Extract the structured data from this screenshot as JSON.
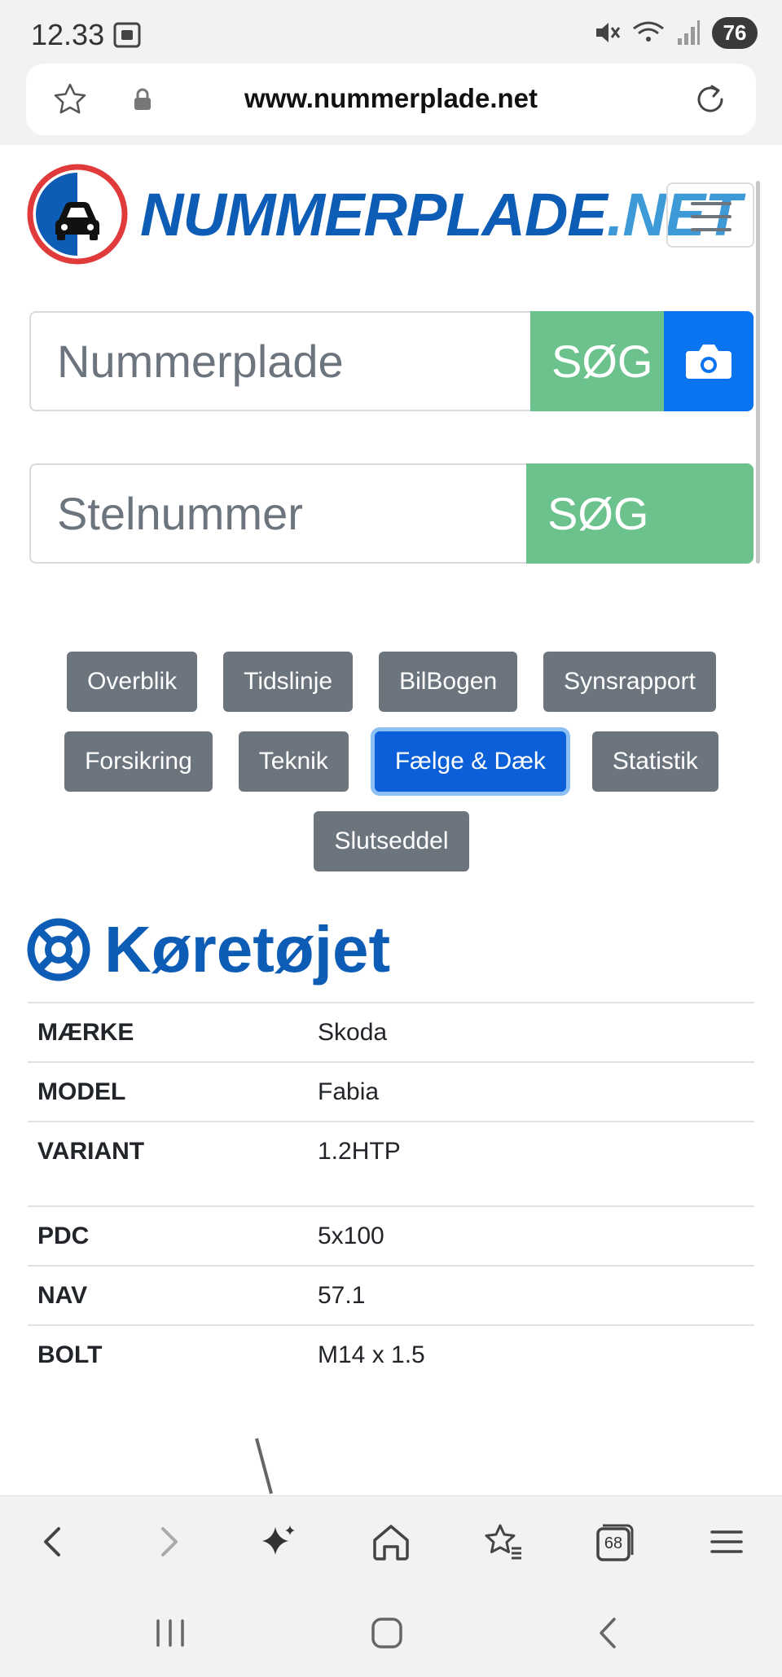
{
  "status_bar": {
    "time": "12.33",
    "battery": "76"
  },
  "browser": {
    "url": "www.nummerplade.net",
    "tab_count": "68"
  },
  "logo": {
    "part1": "NUMMERPLADE",
    "part2": ".NET"
  },
  "search_plate": {
    "placeholder": "Nummerplade",
    "button": "SØG"
  },
  "search_vin": {
    "placeholder": "Stelnummer",
    "button": "SØG"
  },
  "tabs": {
    "row1": [
      "Overblik",
      "Tidslinje",
      "BilBogen",
      "Synsrapport"
    ],
    "row2": [
      "Forsikring",
      "Teknik",
      "Fælge & Dæk",
      "Statistik"
    ],
    "row3": [
      "Slutseddel"
    ],
    "active": "Fælge & Dæk"
  },
  "section": {
    "title": "Køretøjet"
  },
  "specs": [
    {
      "key": "MÆRKE",
      "value": "Skoda"
    },
    {
      "key": "MODEL",
      "value": "Fabia"
    },
    {
      "key": "VARIANT",
      "value": "1.2HTP"
    },
    {
      "key": "PDC",
      "value": "5x100"
    },
    {
      "key": "NAV",
      "value": "57.1"
    },
    {
      "key": "BOLT",
      "value": "M14 x 1.5"
    }
  ],
  "colors": {
    "brand": "#0d5cb5",
    "search_green": "#6cc28c",
    "camera_blue": "#0a73ef",
    "tab_gray": "#6c757d",
    "tab_active": "#0b60d9"
  }
}
